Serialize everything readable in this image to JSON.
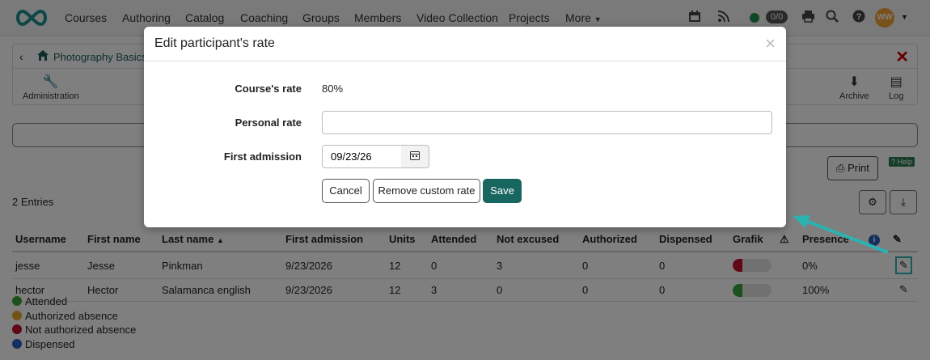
{
  "nav": {
    "items": [
      "Courses",
      "Authoring",
      "Catalog",
      "Coaching",
      "Groups",
      "Members",
      "Video Collection",
      "Projects",
      "More"
    ],
    "counter": "0/0",
    "avatar_initials": "WW"
  },
  "course": {
    "title": "Photography Basics",
    "tools": {
      "administration": "Administration",
      "archive": "Archive",
      "log": "Log"
    }
  },
  "toolbar": {
    "print": "Print",
    "help": "Help"
  },
  "entries": "2 Entries",
  "table": {
    "headers": [
      "Username",
      "First name",
      "Last name",
      "First admission",
      "Units",
      "Attended",
      "Not excused",
      "Authorized",
      "Dispensed",
      "Grafik",
      "Presence"
    ],
    "rows": [
      {
        "username": "jesse",
        "first": "Jesse",
        "last": "Pinkman",
        "admission": "9/23/2026",
        "units": "12",
        "attended": "0",
        "not_excused": "3",
        "authorized": "0",
        "dispensed": "0",
        "presence": "0%",
        "fill_fraction": 0.25,
        "fill_color": "#c0102a"
      },
      {
        "username": "hector",
        "first": "Hector",
        "last": "Salamanca english",
        "admission": "9/23/2026",
        "units": "12",
        "attended": "3",
        "not_excused": "0",
        "authorized": "0",
        "dispensed": "0",
        "presence": "100%",
        "fill_fraction": 0.25,
        "fill_color": "#3aa13a"
      }
    ]
  },
  "legend": [
    {
      "label": "Attended",
      "color": "#3aa13a"
    },
    {
      "label": "Authorized absence",
      "color": "#e0a62a"
    },
    {
      "label": "Not authorized absence",
      "color": "#c0102a"
    },
    {
      "label": "Dispensed",
      "color": "#2a5fbf"
    }
  ],
  "modal": {
    "title": "Edit participant's rate",
    "course_rate_label": "Course's rate",
    "course_rate_value": "80%",
    "personal_rate_label": "Personal rate",
    "personal_rate_value": "",
    "first_admission_label": "First admission",
    "first_admission_value": "09/23/26",
    "buttons": {
      "cancel": "Cancel",
      "remove": "Remove custom rate",
      "save": "Save"
    }
  }
}
